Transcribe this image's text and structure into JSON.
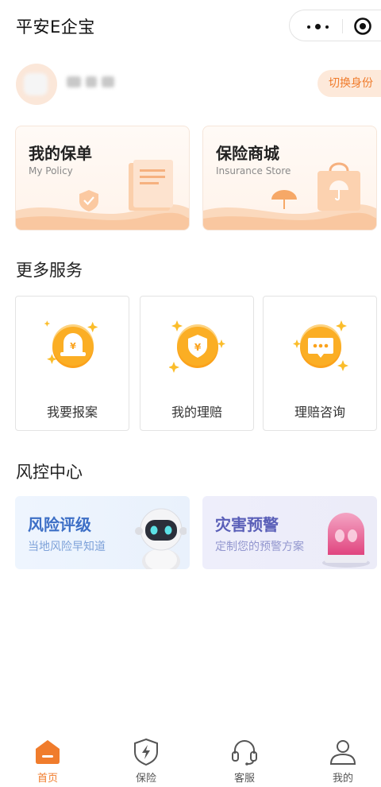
{
  "app": {
    "title": "平安E企宝"
  },
  "capsule": {
    "more_icon": "more-dots-icon",
    "close_icon": "target-circle-icon"
  },
  "user": {
    "switch_label": "切换身份"
  },
  "cards": [
    {
      "title": "我的保单",
      "subtitle": "My Policy"
    },
    {
      "title": "保险商城",
      "subtitle": "Insurance Store"
    }
  ],
  "services": {
    "title": "更多服务",
    "items": [
      {
        "label": "我要报案",
        "icon": "report-case-icon"
      },
      {
        "label": "我的理赔",
        "icon": "claim-shield-icon"
      },
      {
        "label": "理赔咨询",
        "icon": "consult-chat-icon"
      }
    ]
  },
  "risk": {
    "title": "风控中心",
    "items": [
      {
        "title": "风险评级",
        "subtitle": "当地风险早知道"
      },
      {
        "title": "灾害预警",
        "subtitle": "定制您的预警方案"
      }
    ]
  },
  "tabbar": {
    "items": [
      {
        "label": "首页",
        "icon": "home-icon",
        "active": true
      },
      {
        "label": "保险",
        "icon": "insurance-shield-icon"
      },
      {
        "label": "客服",
        "icon": "headset-icon"
      },
      {
        "label": "我的",
        "icon": "user-icon"
      }
    ]
  },
  "colors": {
    "accent": "#f07c2c",
    "orange_icon": "#fba21b",
    "risk_blue": "#3d6fc6",
    "risk_purple": "#5a5fb8"
  }
}
